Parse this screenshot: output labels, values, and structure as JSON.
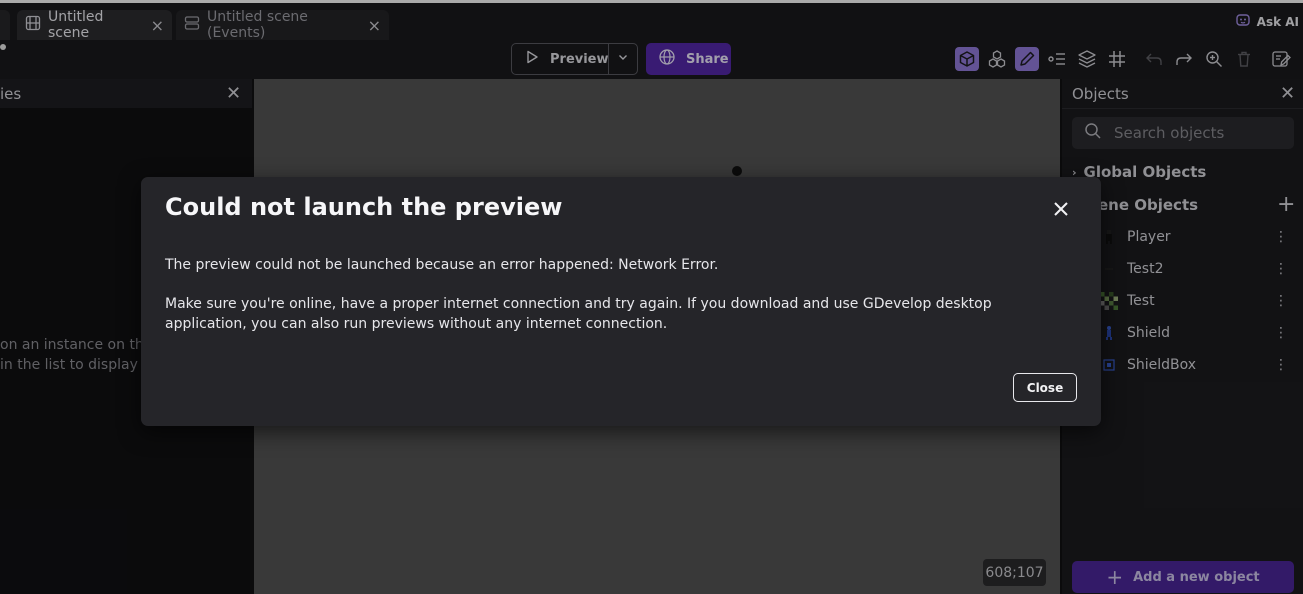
{
  "tabs": [
    {
      "label": "Untitled scene",
      "active": true
    },
    {
      "label": "Untitled scene (Events)",
      "active": false
    }
  ],
  "ask_ai_label": "Ask AI",
  "toolbar": {
    "preview_label": "Preview",
    "share_label": "Share"
  },
  "left_panel": {
    "title": "ies",
    "hint_line1": "on an instance on the",
    "hint_line2": "in the list to display th"
  },
  "canvas": {
    "coords": "608;107"
  },
  "objects_panel": {
    "title": "Objects",
    "search_placeholder": "Search objects",
    "global_objects_label": "Global Objects",
    "scene_objects_label": "ene Objects",
    "items": [
      {
        "name": "Player"
      },
      {
        "name": "Test2"
      },
      {
        "name": "Test"
      },
      {
        "name": "Shield"
      },
      {
        "name": "ShieldBox"
      }
    ],
    "add_button_label": "Add a new object"
  },
  "dialog": {
    "title": "Could not launch the preview",
    "paragraph1": "The preview could not be launched because an error happened: Network Error.",
    "paragraph2": "Make sure you're online, have a proper internet connection and try again. If you download and use GDevelop desktop application, you can also run previews without any internet connection.",
    "close_button_label": "Close"
  },
  "colors": {
    "accent": "#5227a5",
    "active_tool": "#8f78d6",
    "canvas": "#525252"
  }
}
